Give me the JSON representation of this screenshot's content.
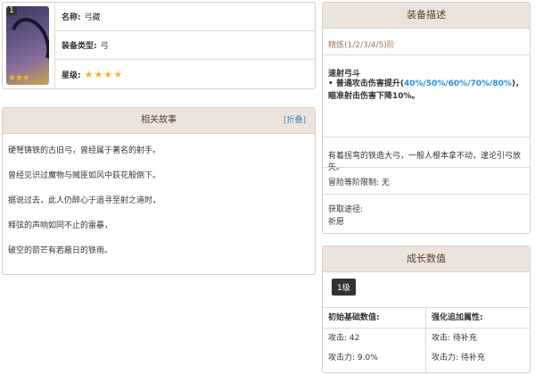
{
  "info": {
    "level_badge": "1",
    "stars": "★★★",
    "name_label": "名称:",
    "name_value": "弓藏",
    "type_label": "装备类型:",
    "type_value": "弓",
    "rarity_label": "星级:",
    "rarity_stars": "★★★★"
  },
  "story": {
    "title": "相关故事",
    "collapse": "[折叠]",
    "lines": [
      "硬弩铸铁的古旧弓，曾经属于著名的射手。",
      "曾经见识过魔物与贼匪如风中荻花般倒下。",
      "据说过去，此人仍醉心于追寻至射之道时，",
      "释弦的声响如同不止的雷暴，",
      "破空的箭芒有若蔽日的铁雨。"
    ]
  },
  "desc": {
    "title": "装备描述",
    "refine": "精炼(1/2/3/4/5)阶",
    "skill_name": "速射弓斗",
    "skill_pre": "• 普通攻击伤害提升(",
    "skill_values": "40%/50%/60%/70%/80%",
    "skill_post": ")，瞄准射击伤害下降10%。",
    "flavor": "有着拐弯的铁造大弓，一般人根本拿不动，遑论引弓放矢。",
    "ascension": "冒险等阶限制: 无",
    "obtain_label": "获取途径:",
    "obtain_value": "祈愿"
  },
  "growth": {
    "title": "成长数值",
    "level_button": "1级",
    "base_header": "初始基础数值:",
    "bonus_header": "强化追加属性:",
    "base_atk": "攻击: 42",
    "base_sub": "攻击力: 9.0%",
    "bonus_atk": "攻击: 待补充",
    "bonus_sub": "攻击力: 待补充"
  }
}
